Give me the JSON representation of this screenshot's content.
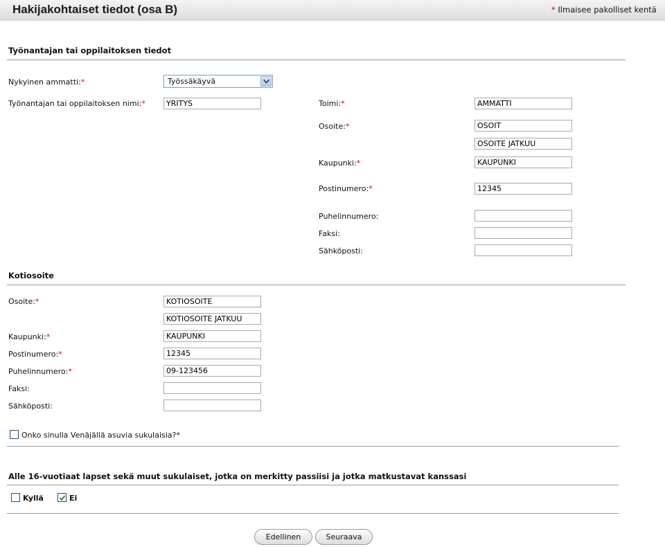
{
  "header": {
    "title": "Hakijakohtaiset tiedot (osa B)",
    "required_star": "*",
    "required_note": "Ilmaisee pakolliset kentä"
  },
  "employer": {
    "section_title": "Työnantajan tai oppilaitoksen tiedot",
    "occupation_label": "Nykyinen ammatti:",
    "occupation_value": "Työssäkäyvä",
    "name_label": "Työnantajan tai oppilaitoksen nimi:",
    "name_value": "YRITYS",
    "role_label": "Toimi:",
    "role_value": "AMMATTI",
    "address_label": "Osoite:",
    "address1_value": "OSOIT",
    "address2_value": "OSOITE JATKUU",
    "city_label": "Kaupunki:",
    "city_value": "KAUPUNKI",
    "postal_label": "Postinumero:",
    "postal_value": "12345",
    "phone_label": "Puhelinnumero:",
    "phone_value": "",
    "fax_label": "Faksi:",
    "fax_value": "",
    "email_label": "Sähköposti:",
    "email_value": ""
  },
  "home": {
    "section_title": "Kotiosoite",
    "address_label": "Osoite:",
    "address1_value": "KOTIOSOITE",
    "address2_value": "KOTIOSOITE JATKUU",
    "city_label": "Kaupunki:",
    "city_value": "KAUPUNKI",
    "postal_label": "Postinumero:",
    "postal_value": "12345",
    "phone_label": "Puhelinnumero:",
    "phone_value": "09-123456",
    "fax_label": "Faksi:",
    "fax_value": "",
    "email_label": "Sähköposti:",
    "email_value": ""
  },
  "relatives": {
    "label": "Onko sinulla Venäjällä asuvia sukulaisia?*",
    "checked": false
  },
  "children": {
    "section_title": "Alle 16-vuotiaat lapset sekä muut sukulaiset, jotka on merkitty passiisi ja jotka matkustavat kanssasi",
    "yes_label": "Kyllä",
    "yes_checked": false,
    "no_label": "Ei",
    "no_checked": true
  },
  "buttons": {
    "prev_label": "Edellinen",
    "next_label": "Seuraava"
  }
}
